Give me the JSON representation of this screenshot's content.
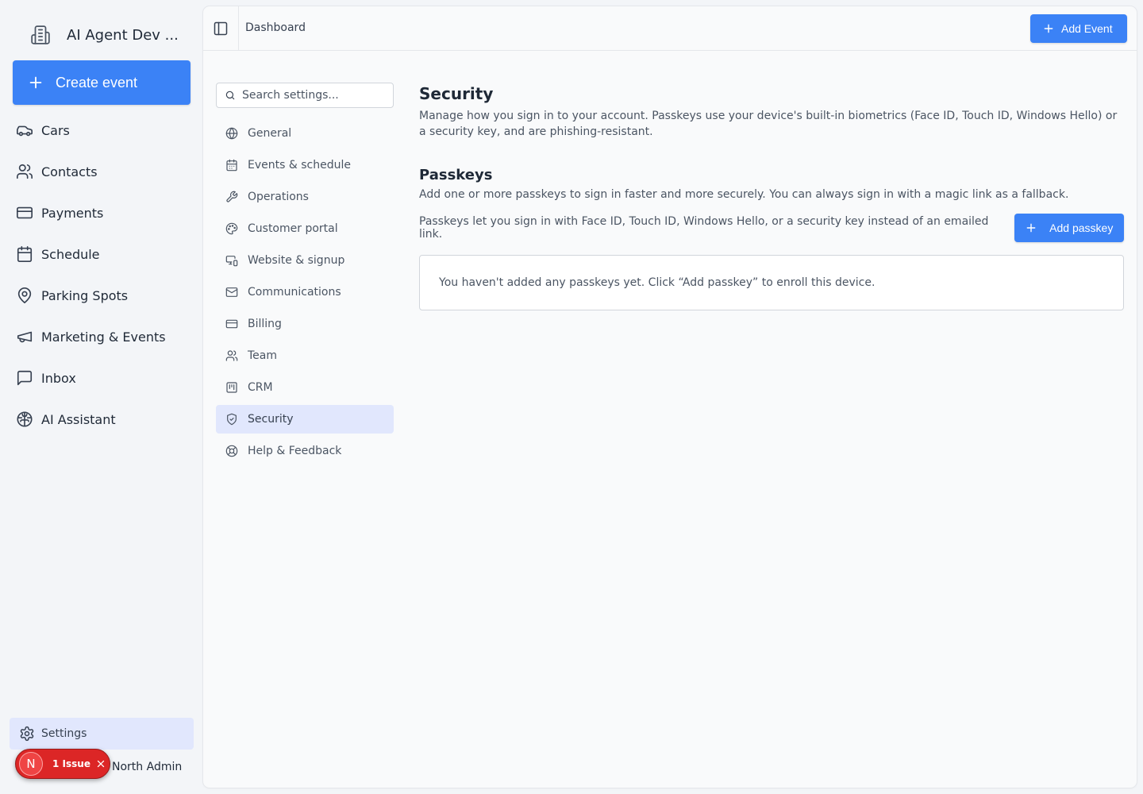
{
  "sidebar": {
    "brand": {
      "name": "AI Agent Dev ...",
      "icon": "building-icon"
    },
    "create_button": {
      "label": "Create event",
      "icon": "plus-icon"
    },
    "items": [
      {
        "label": "Cars",
        "icon": "car-icon"
      },
      {
        "label": "Contacts",
        "icon": "users-icon"
      },
      {
        "label": "Payments",
        "icon": "credit-card-icon"
      },
      {
        "label": "Schedule",
        "icon": "calendar-icon"
      },
      {
        "label": "Parking Spots",
        "icon": "map-pin-icon"
      },
      {
        "label": "Marketing & Events",
        "icon": "megaphone-icon"
      },
      {
        "label": "Inbox",
        "icon": "message-square-icon"
      },
      {
        "label": "AI Assistant",
        "icon": "brain-icon"
      }
    ],
    "settings": {
      "label": "Settings",
      "icon": "gear-icon"
    },
    "user": {
      "name": "North Admin"
    },
    "issue_badge": {
      "avatar_letter": "N",
      "text": "1 Issue",
      "color": "#dc2626"
    }
  },
  "topbar": {
    "breadcrumb": "Dashboard",
    "add_event_label": "Add Event"
  },
  "settings_nav": {
    "search_placeholder": "Search settings...",
    "items": [
      {
        "label": "General",
        "icon": "globe-icon"
      },
      {
        "label": "Events & schedule",
        "icon": "calendar-icon"
      },
      {
        "label": "Operations",
        "icon": "wrench-icon"
      },
      {
        "label": "Customer portal",
        "icon": "palette-icon"
      },
      {
        "label": "Website & signup",
        "icon": "monitor-smartphone-icon"
      },
      {
        "label": "Communications",
        "icon": "mail-icon"
      },
      {
        "label": "Billing",
        "icon": "credit-card-icon"
      },
      {
        "label": "Team",
        "icon": "users-icon"
      },
      {
        "label": "CRM",
        "icon": "kanban-icon"
      },
      {
        "label": "Security",
        "icon": "shield-check-icon",
        "active": true
      },
      {
        "label": "Help & Feedback",
        "icon": "life-buoy-icon"
      }
    ]
  },
  "content": {
    "title": "Security",
    "description": "Manage how you sign in to your account. Passkeys use your device's built-in biometrics (Face ID, Touch ID, Windows Hello) or a security key, and are phishing-resistant.",
    "passkeys": {
      "title": "Passkeys",
      "description": "Add one or more passkeys to sign in faster and more securely. You can always sign in with a magic link as a fallback.",
      "info": "Passkeys let you sign in with Face ID, Touch ID, Windows Hello, or a security key instead of an emailed link.",
      "add_label": "Add passkey",
      "empty_message": "You haven't added any passkeys yet. Click “Add passkey” to enroll this device."
    }
  },
  "colors": {
    "accent": "#3b82f6",
    "active_bg": "#e1e7fd",
    "background": "#f3f5f8"
  }
}
